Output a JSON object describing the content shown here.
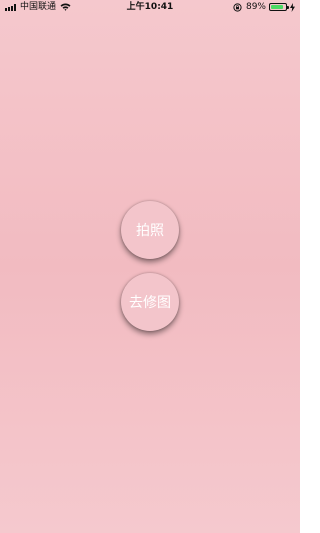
{
  "status_bar": {
    "carrier": "中国联通",
    "time": "上午10:41",
    "battery_percent": "89%",
    "battery_level": 0.89,
    "icons": [
      "signal-icon",
      "wifi-icon",
      "lock-rotation-icon",
      "battery-icon",
      "charging-icon"
    ]
  },
  "actions": {
    "take_photo_label": "拍照",
    "edit_photo_label": "去修图"
  },
  "colors": {
    "background": "#f2bbc1",
    "button": "#f3c5cb",
    "button_text": "#ffffff",
    "battery": "#4cd964"
  }
}
